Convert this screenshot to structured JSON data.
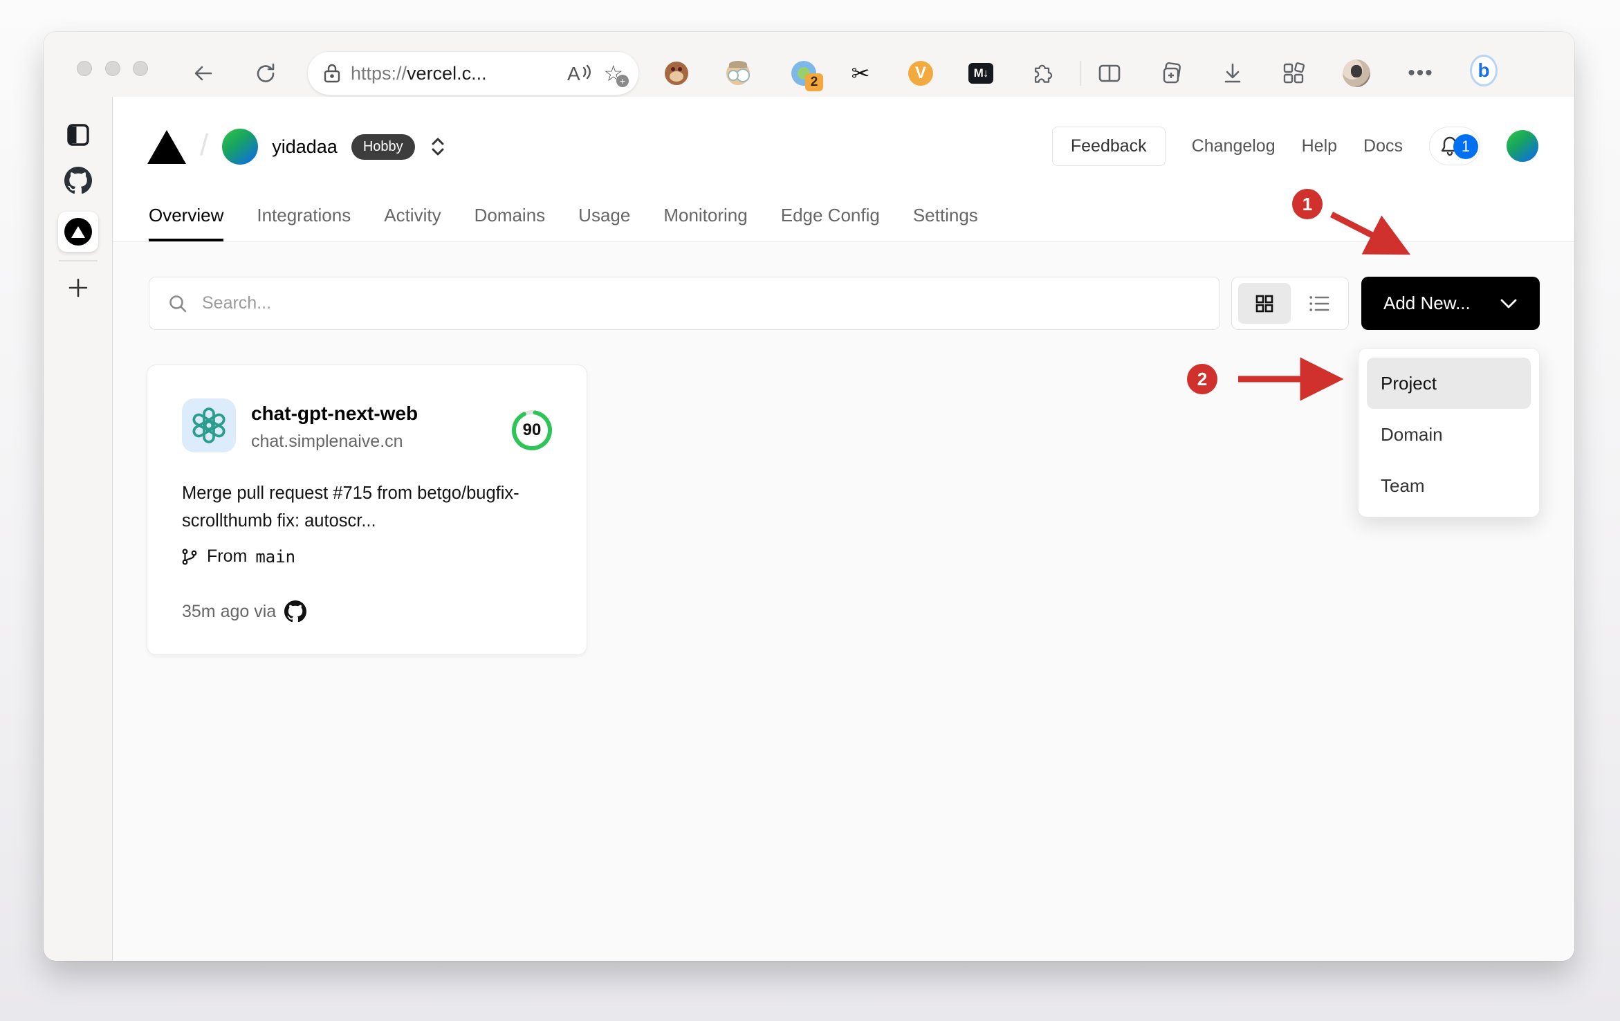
{
  "browser": {
    "url": {
      "prefix": "https://",
      "host": "vercel.c..."
    },
    "extensions": {
      "translate_badge": "2",
      "video_label": "V",
      "markdownload_label": "M↓",
      "scissors_glyph": "✂"
    },
    "more_glyph": "•••",
    "bing_label": "b"
  },
  "vercel": {
    "team": "yidadaa",
    "plan": "Hobby",
    "feedback": "Feedback",
    "links": [
      {
        "label": "Changelog"
      },
      {
        "label": "Help"
      },
      {
        "label": "Docs"
      }
    ],
    "notification_count": "1",
    "tabs": [
      {
        "label": "Overview"
      },
      {
        "label": "Integrations"
      },
      {
        "label": "Activity"
      },
      {
        "label": "Domains"
      },
      {
        "label": "Usage"
      },
      {
        "label": "Monitoring"
      },
      {
        "label": "Edge Config"
      },
      {
        "label": "Settings"
      }
    ],
    "toolbar": {
      "search_placeholder": "Search...",
      "add_new": "Add New..."
    },
    "dropdown": {
      "items": [
        {
          "label": "Project"
        },
        {
          "label": "Domain"
        },
        {
          "label": "Team"
        }
      ],
      "highlighted": "Project"
    },
    "card": {
      "name": "chat-gpt-next-web",
      "domain": "chat.simplenaive.cn",
      "score": "90",
      "score_pct": 90,
      "commit": "Merge pull request #715 from betgo/bugfix-scrollthumb fix: autoscr...",
      "branch_label": "From",
      "branch": "main",
      "deployed_label": "35m ago via"
    }
  },
  "annotations": {
    "step1": "1",
    "step2": "2"
  },
  "colors": {
    "annotation_red": "#d0312d",
    "notification_blue": "#0070f3",
    "score_green": "#2ec558",
    "openai_teal": "#2a9d8f",
    "brand_black": "#000000",
    "content_bg": "#fafafa"
  }
}
